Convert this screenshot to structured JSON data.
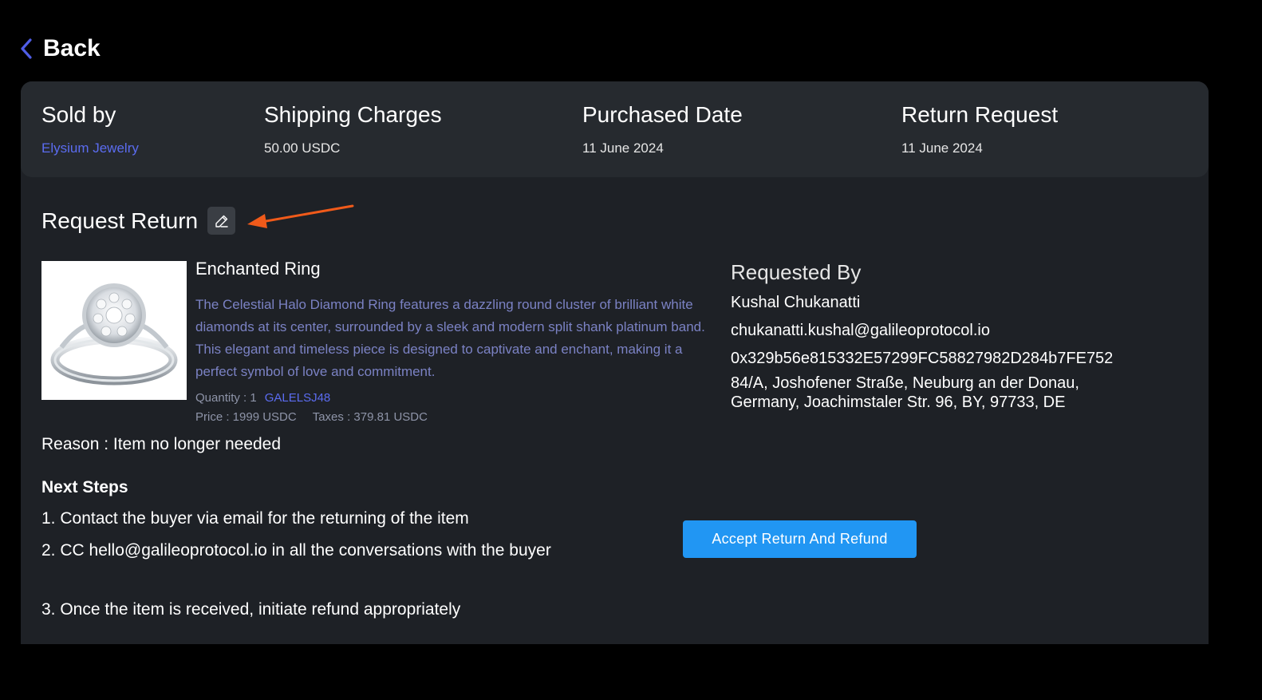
{
  "nav": {
    "back_label": "Back"
  },
  "summary": {
    "sold_by": {
      "title": "Sold by",
      "value": "Elysium Jewelry"
    },
    "shipping": {
      "title": "Shipping Charges",
      "value": "50.00 USDC"
    },
    "purchased": {
      "title": "Purchased Date",
      "value": "11 June 2024"
    },
    "return_request": {
      "title": "Return Request",
      "value": "11 June 2024"
    }
  },
  "request": {
    "title": "Request Return",
    "product": {
      "name": "Enchanted Ring",
      "description": "The Celestial Halo Diamond Ring features a dazzling round cluster of brilliant white diamonds at its center, surrounded by a sleek and modern split shank platinum band. This elegant and timeless piece is designed to captivate and enchant, making it a perfect symbol of love and commitment.",
      "quantity": "Quantity : 1",
      "sku": "GALELSJ48",
      "price": "Price : 1999 USDC",
      "taxes": "Taxes : 379.81 USDC"
    },
    "reason": "Reason : Item no longer needed"
  },
  "requested_by": {
    "title": "Requested By",
    "name": "Kushal Chukanatti",
    "email": "chukanatti.kushal@galileoprotocol.io",
    "wallet": "0x329b56e815332E57299FC58827982D284b7FE752",
    "address": "84/A, Joshofener Straße, Neuburg an der Donau, Germany, Joachimstaler Str. 96, BY, 97733, DE"
  },
  "next_steps": {
    "title": "Next Steps",
    "steps": [
      "1. Contact the buyer via email for the returning of the item",
      "2. CC hello@galileoprotocol.io in all the conversations with the buyer",
      "3. Once the item is received, initiate refund appropriately"
    ]
  },
  "actions": {
    "accept_label": "Accept Return And Refund"
  },
  "colors": {
    "background": "#000000",
    "panel": "#1e2126",
    "summary": "#262a2f",
    "link": "#5b6cf0",
    "description": "#7b82c4",
    "button": "#2196f3",
    "annotation_arrow": "#f05a1a"
  },
  "icons": {
    "back": "chevron-left-icon",
    "edit": "pencil-icon",
    "annotation": "arrow-left-annotation",
    "product": "ring-image"
  }
}
